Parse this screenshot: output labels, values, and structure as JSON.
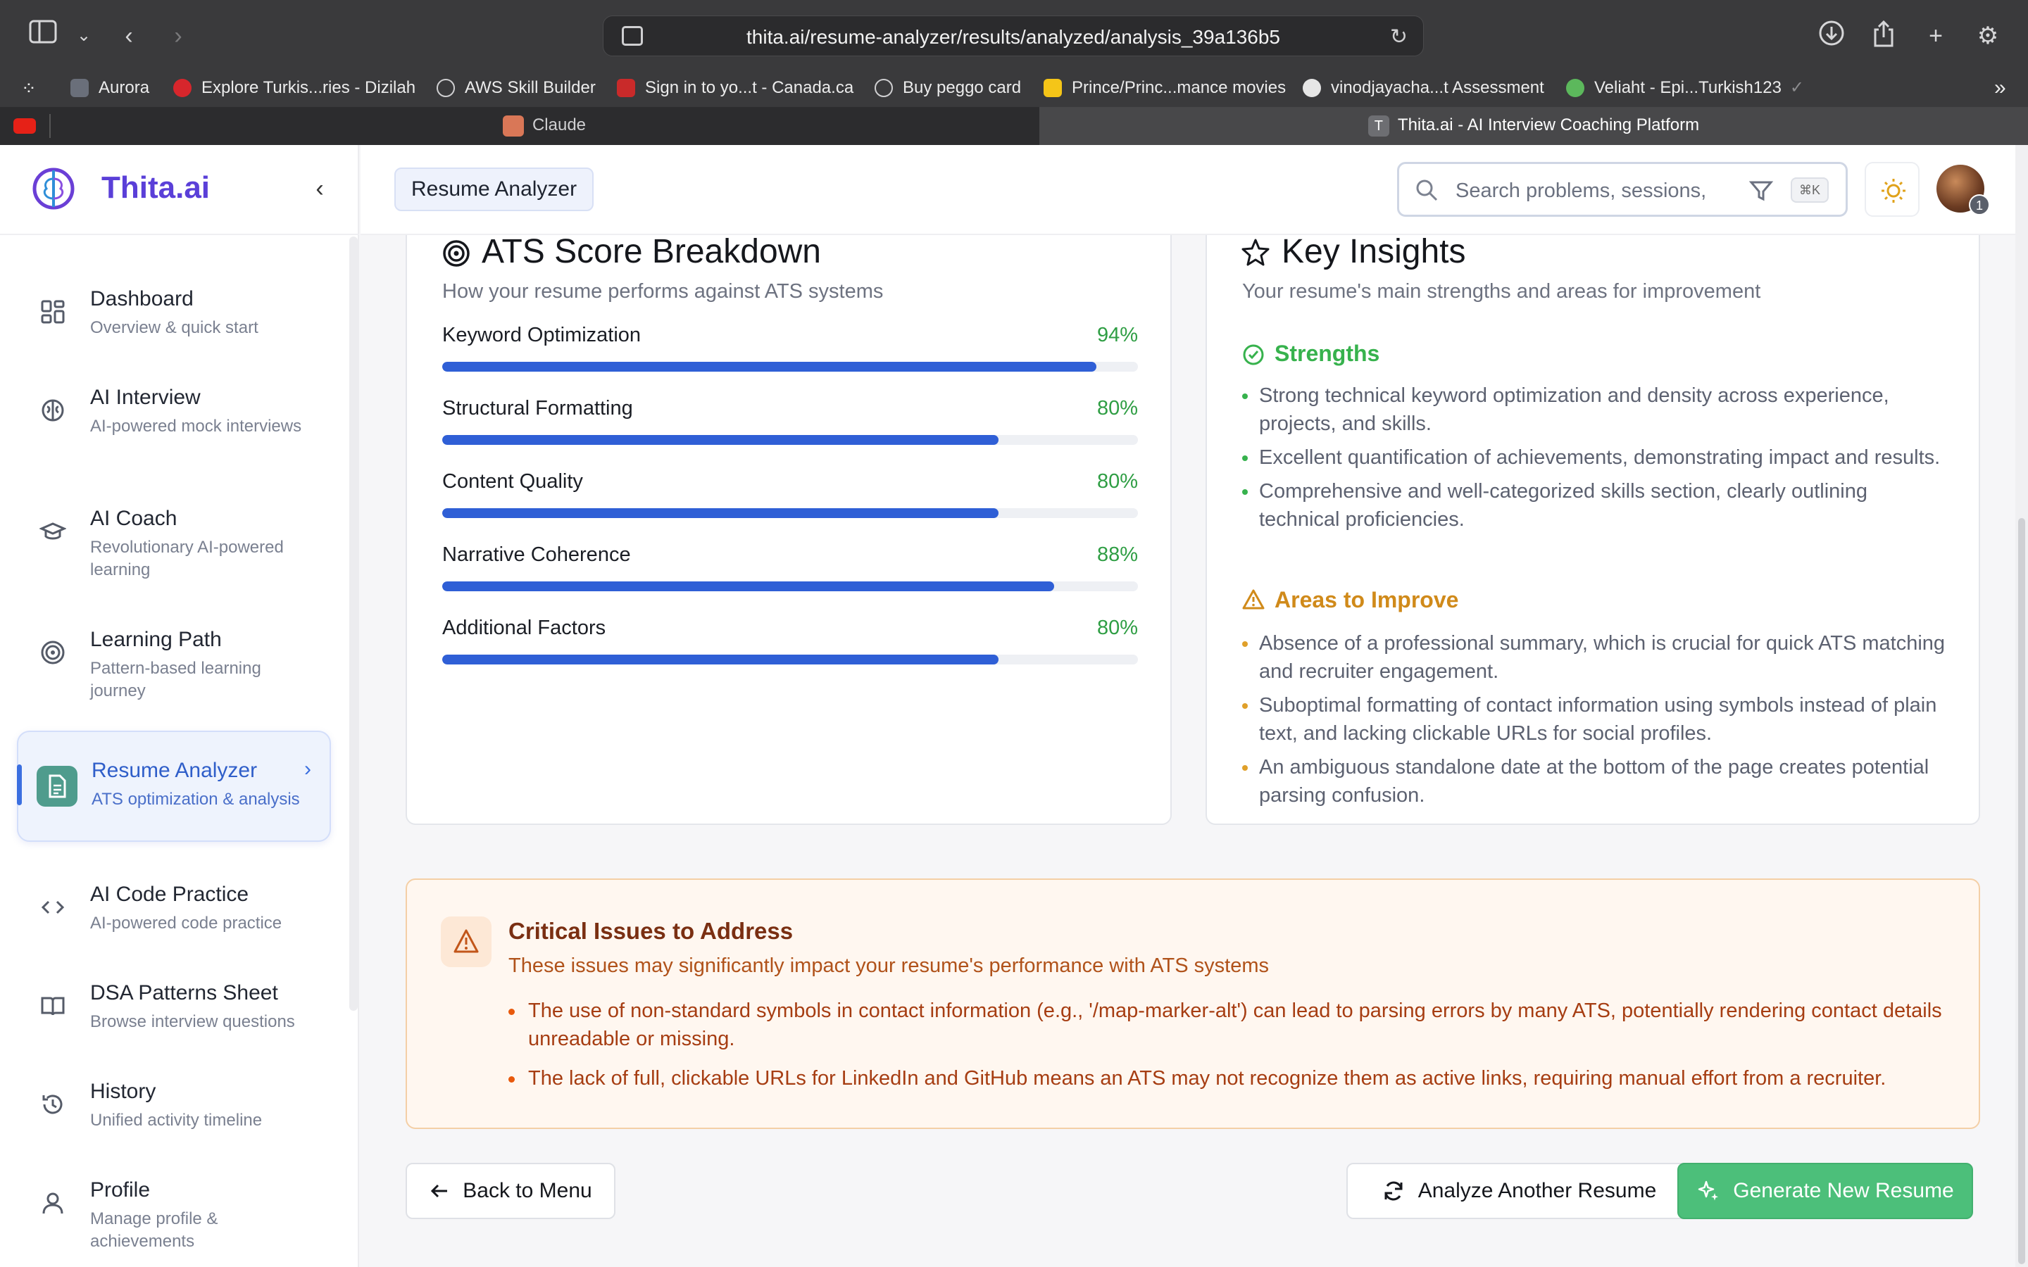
{
  "browser": {
    "url": "thita.ai/resume-analyzer/results/analyzed/analysis_39a136b5",
    "bookmarks": [
      "Aurora",
      "Explore Turkis...ries - Dizilah",
      "AWS Skill Builder",
      "Sign in to yo...t - Canada.ca",
      "Buy peggo card",
      "Prince/Princ...mance movies",
      "vinodjayacha...t Assessment",
      "Veliaht - Epi...Turkish123"
    ],
    "tabs": [
      "Claude",
      "Thita.ai - AI Interview Coaching Platform"
    ],
    "colors": {
      "chrome": "#3a3a3c",
      "active_tab": "#48484a"
    }
  },
  "brand": {
    "name": "Thita.ai"
  },
  "sidebar": {
    "items": [
      {
        "title": "Dashboard",
        "subtitle": "Overview & quick start",
        "icon": "grid-icon"
      },
      {
        "title": "AI Interview",
        "subtitle": "AI-powered mock interviews",
        "icon": "brain-icon"
      },
      {
        "title": "AI Coach",
        "subtitle": "Revolutionary AI-powered learning",
        "icon": "graduation-cap-icon"
      },
      {
        "title": "Learning Path",
        "subtitle": "Pattern-based learning journey",
        "icon": "target-icon"
      },
      {
        "title": "Resume Analyzer",
        "subtitle": "ATS optimization & analysis",
        "icon": "document-icon",
        "active": true
      },
      {
        "title": "AI Code Practice",
        "subtitle": "AI-powered code practice",
        "icon": "code-icon"
      },
      {
        "title": "DSA Patterns Sheet",
        "subtitle": "Browse interview questions",
        "icon": "book-icon"
      },
      {
        "title": "History",
        "subtitle": "Unified activity timeline",
        "icon": "history-icon"
      },
      {
        "title": "Profile",
        "subtitle": "Manage profile & achievements",
        "icon": "user-icon"
      }
    ]
  },
  "header": {
    "breadcrumb": "Resume Analyzer",
    "search_placeholder": "Search problems, sessions,",
    "shortcut": "⌘K",
    "avatar_badge": "1"
  },
  "ats": {
    "title": "ATS Score Breakdown",
    "subtitle": "How your resume performs against ATS systems",
    "scores": [
      {
        "label": "Keyword Optimization",
        "value": "94%",
        "fraction": 0.94
      },
      {
        "label": "Structural Formatting",
        "value": "80%",
        "fraction": 0.8
      },
      {
        "label": "Content Quality",
        "value": "80%",
        "fraction": 0.8
      },
      {
        "label": "Narrative Coherence",
        "value": "88%",
        "fraction": 0.88
      },
      {
        "label": "Additional Factors",
        "value": "80%",
        "fraction": 0.8
      }
    ]
  },
  "insights": {
    "title": "Key Insights",
    "subtitle": "Your resume's main strengths and areas for improvement",
    "strengths_title": "Strengths",
    "strengths": [
      "Strong technical keyword optimization and density across experience, projects, and skills.",
      "Excellent quantification of achievements, demonstrating impact and results.",
      "Comprehensive and well-categorized skills section, clearly outlining technical proficiencies."
    ],
    "improve_title": "Areas to Improve",
    "improve": [
      "Absence of a professional summary, which is crucial for quick ATS matching and recruiter engagement.",
      "Suboptimal formatting of contact information using symbols instead of plain text, and lacking clickable URLs for social profiles.",
      "An ambiguous standalone date at the bottom of the page creates potential parsing confusion."
    ]
  },
  "critical": {
    "title": "Critical Issues to Address",
    "subtitle": "These issues may significantly impact your resume's performance with ATS systems",
    "items": [
      "The use of non-standard symbols in contact information (e.g., '/map-marker-alt') can lead to parsing errors by many ATS, potentially rendering contact details unreadable or missing.",
      "The lack of full, clickable URLs for LinkedIn and GitHub means an ATS may not recognize them as active links, requiring manual effort from a recruiter."
    ]
  },
  "actions": {
    "back": "Back to Menu",
    "analyze_another": "Analyze Another Resume",
    "generate": "Generate New Resume"
  },
  "colors": {
    "accent": "#2f5fd6",
    "score_text": "#2f9e44",
    "strengths": "#37b24d",
    "improve": "#d08a1a",
    "critical": "#a63d12",
    "primary_button": "#4cbf7a"
  }
}
